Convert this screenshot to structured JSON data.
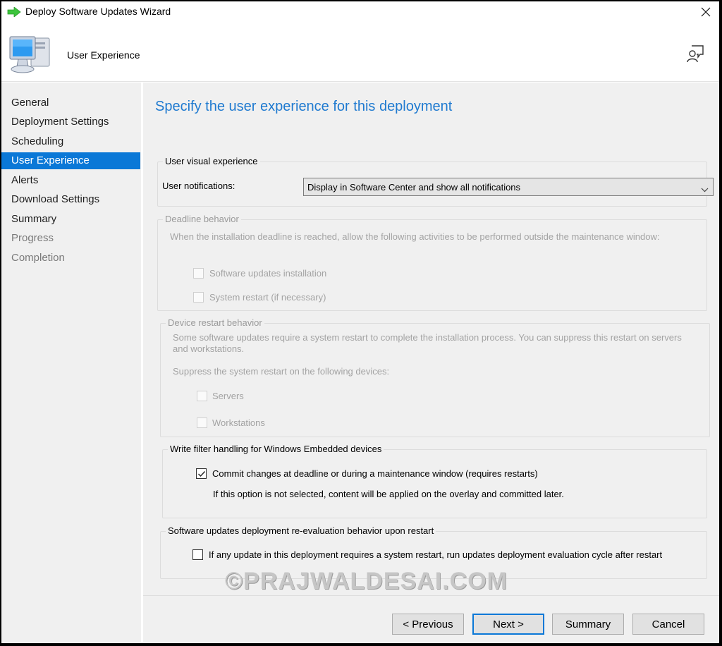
{
  "window": {
    "title": "Deploy Software Updates Wizard",
    "title_icon": "green-arrow-icon",
    "close_icon": "close-icon"
  },
  "header": {
    "title": "User Experience",
    "icon": "computer-icon",
    "feedback_icon": "feedback-icon"
  },
  "sidebar": {
    "items": [
      {
        "label": "General",
        "state": "normal"
      },
      {
        "label": "Deployment Settings",
        "state": "normal"
      },
      {
        "label": "Scheduling",
        "state": "normal"
      },
      {
        "label": "User Experience",
        "state": "active"
      },
      {
        "label": "Alerts",
        "state": "normal"
      },
      {
        "label": "Download Settings",
        "state": "normal"
      },
      {
        "label": "Summary",
        "state": "normal"
      },
      {
        "label": "Progress",
        "state": "disabled"
      },
      {
        "label": "Completion",
        "state": "disabled"
      }
    ]
  },
  "main": {
    "heading": "Specify the user experience for this deployment",
    "user_visual_experience": {
      "legend": "User visual experience",
      "notifications_label": "User notifications:",
      "notifications_value": "Display in Software Center and show all notifications"
    },
    "deadline_behavior": {
      "legend": "Deadline behavior",
      "description": "When the installation deadline is reached, allow the following activities to be performed outside the maintenance window:",
      "options": [
        {
          "label": "Software updates installation",
          "checked": false,
          "enabled": false
        },
        {
          "label": "System restart (if necessary)",
          "checked": false,
          "enabled": false
        }
      ]
    },
    "device_restart_behavior": {
      "legend": "Device restart behavior",
      "description_line1": "Some software updates require a system restart to complete the installation process. You can suppress this restart on servers",
      "description_line2": "and workstations.",
      "suppress_label": "Suppress the system restart on the following devices:",
      "options": [
        {
          "label": "Servers",
          "checked": false,
          "enabled": false
        },
        {
          "label": "Workstations",
          "checked": false,
          "enabled": false
        }
      ]
    },
    "write_filter": {
      "legend": "Write filter handling for Windows Embedded devices",
      "option": {
        "label": "Commit changes at deadline or during a maintenance window (requires restarts)",
        "checked": true,
        "enabled": true
      },
      "note": "If this option is not selected, content will be applied on the overlay and committed later."
    },
    "reevaluation": {
      "legend": "Software updates deployment re-evaluation behavior upon restart",
      "option": {
        "label": "If any update in this deployment requires a system restart, run updates deployment evaluation cycle after restart",
        "checked": false,
        "enabled": true
      }
    }
  },
  "footer": {
    "previous_label": "< Previous",
    "next_label": "Next >",
    "summary_label": "Summary",
    "cancel_label": "Cancel"
  },
  "watermark": "©PRAJWALDESAI.COM",
  "colors": {
    "accent": "#0a78d7",
    "heading": "#1f7ad0",
    "panel_bg": "#f0f0f0",
    "disabled_text": "#a3a3a3"
  }
}
